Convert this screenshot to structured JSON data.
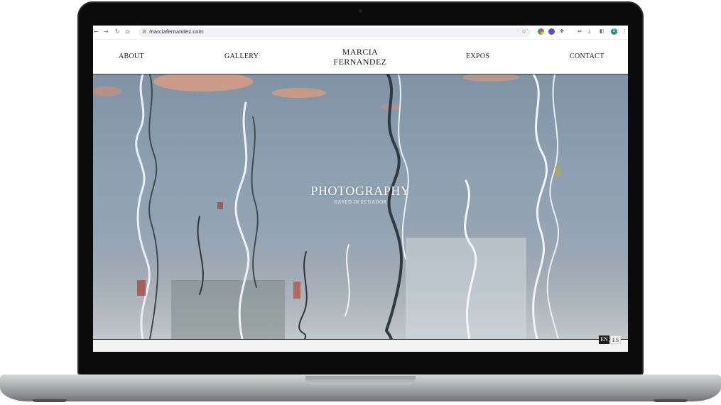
{
  "browser": {
    "url": "marciafernandez.com",
    "icons": [
      "back-icon",
      "forward-icon",
      "reload-icon",
      "home-icon",
      "site-settings-icon",
      "bookmark-star-icon",
      "extensions-icon",
      "download-icon",
      "side-panel-icon",
      "menu-icon"
    ],
    "profile_initial": "S"
  },
  "site": {
    "logo_line1": "MARCIA",
    "logo_line2": "FERNANDEZ",
    "nav": {
      "about": "ABOUT",
      "gallery": "GALLERY",
      "expos": "EXPOS",
      "contact": "CONTACT"
    },
    "hero": {
      "title": "PHOTOGRAPHY",
      "subtitle": "BASED IN ECUADOR"
    },
    "languages": [
      "EN",
      "ES"
    ],
    "active_language": "EN"
  },
  "colors": {
    "water": "#8da0b2",
    "accent_dark": "#1e1e1e"
  }
}
